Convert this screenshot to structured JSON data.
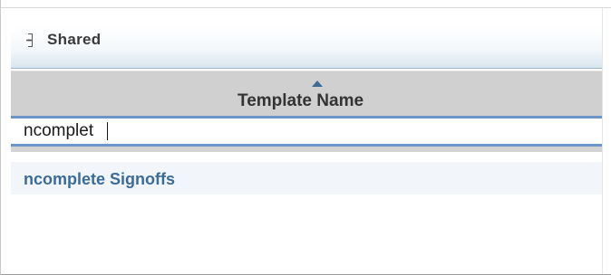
{
  "group": {
    "title": "Shared",
    "collapse_icon": "minus-box-icon"
  },
  "grid": {
    "column_header": "Template Name",
    "sort_direction": "ascending",
    "sort_icon": "sort-ascending-icon",
    "filter_value": "ncomplet",
    "rows": [
      {
        "label": "ncomplete Signoffs"
      }
    ]
  },
  "colors": {
    "header_bg": "#d0d0d0",
    "filter_border": "#6c95c8",
    "row_bg": "#f2f6fa",
    "row_text": "#3b6c99",
    "sort_arrow": "#3e6b95"
  }
}
